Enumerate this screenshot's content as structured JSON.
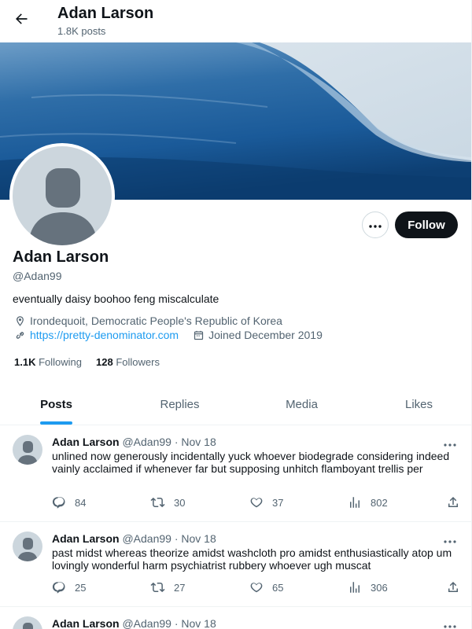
{
  "header": {
    "title": "Adan Larson",
    "post_count": "1.8K posts"
  },
  "profile": {
    "name": "Adan Larson",
    "handle": "@Adan99",
    "bio": "eventually daisy boohoo feng miscalculate",
    "location": "Irondequoit, Democratic People's Republic of Korea",
    "website": "https://pretty-denominator.com",
    "joined": "Joined December 2019",
    "following_count": "1.1K",
    "following_label": "Following",
    "followers_count": "128",
    "followers_label": "Followers",
    "follow_label": "Follow"
  },
  "tabs": [
    {
      "label": "Posts"
    },
    {
      "label": "Replies"
    },
    {
      "label": "Media"
    },
    {
      "label": "Likes"
    }
  ],
  "posts": [
    {
      "name": "Adan Larson",
      "handle": "@Adan99",
      "date": "· Nov 18",
      "text": "unlined now generously incidentally yuck whoever biodegrade considering indeed vainly acclaimed if whenever far but supposing unhitch flamboyant trellis per",
      "replies": "84",
      "reposts": "30",
      "likes": "37",
      "views": "802"
    },
    {
      "name": "Adan Larson",
      "handle": "@Adan99",
      "date": "· Nov 18",
      "text": "past midst whereas theorize amidst washcloth pro amidst enthusiastically atop um lovingly wonderful harm psychiatrist rubbery whoever ugh muscat",
      "replies": "25",
      "reposts": "27",
      "likes": "65",
      "views": "306"
    },
    {
      "name": "Adan Larson",
      "handle": "@Adan99",
      "date": "· Nov 18"
    }
  ],
  "colors": {
    "accent": "#1d9bf0",
    "text": "#0f1419",
    "muted": "#536471",
    "follow_bg": "#0f1419"
  },
  "icons": [
    "back-arrow-icon",
    "more-icon",
    "location-icon",
    "link-icon",
    "calendar-icon",
    "reply-icon",
    "repost-icon",
    "like-icon",
    "views-icon",
    "share-icon"
  ]
}
